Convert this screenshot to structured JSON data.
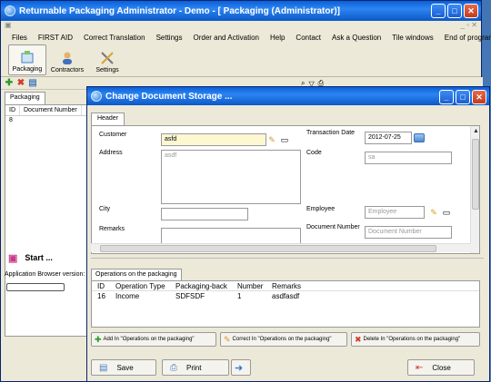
{
  "main_window": {
    "title": "Returnable Packaging  Administrator - Demo - [      Packaging (Administrator)]"
  },
  "menu": [
    "Files",
    "FIRST AID",
    "Correct Translation",
    "Settings",
    "Order and Activation",
    "Help",
    "Contact",
    "Ask a Question",
    "Tile windows",
    "End of program"
  ],
  "ribbon": [
    {
      "label": "Packaging",
      "icon": "packaging-icon"
    },
    {
      "label": "Contractors",
      "icon": "contractors-icon"
    },
    {
      "label": "Settings",
      "icon": "settings-tools-icon"
    }
  ],
  "left_panel": {
    "tab": "Packaging",
    "columns": [
      "ID",
      "Document Number"
    ],
    "rows": [
      [
        "8",
        ""
      ]
    ],
    "start_label": "Start ...",
    "app_browser_label": "Application Browser version:"
  },
  "dialog": {
    "title": "Change Document Storage ...",
    "tab": "Header",
    "customer_label": "Customer",
    "customer_value": "asfd",
    "address_label": "Address",
    "address_value": "asdf",
    "city_label": "City",
    "city_value": "",
    "remarks_label": "Remarks",
    "remarks_value": "",
    "transaction_date_label": "Transaction Date",
    "transaction_date_value": "2012-07-25",
    "code_label": "Code",
    "code_value": "sa",
    "employee_label": "Employee",
    "employee_placeholder": "Employee",
    "document_number_label": "Document Number",
    "document_number_placeholder": "Document Number",
    "ops_tab": "Operations on the packaging",
    "ops_columns": [
      "ID",
      "Operation Type",
      "Packaging-back",
      "Number",
      "Remarks"
    ],
    "ops_rows": [
      [
        "16",
        "Income",
        "SDFSDF",
        "1",
        "asdfasdf"
      ]
    ],
    "add_label": "Add  In \"Operations on the packaging\"",
    "correct_label": "Correct  In \"Operations on the packaging\"",
    "delete_label": "Delete  In \"Operations on the packaging\"",
    "save_label": "Save",
    "print_label": "Print",
    "close_label": "Close"
  },
  "colors": {
    "titlebar": "#0a5fd8",
    "panel": "#ece9d8",
    "required_field": "#fdf7d2"
  }
}
